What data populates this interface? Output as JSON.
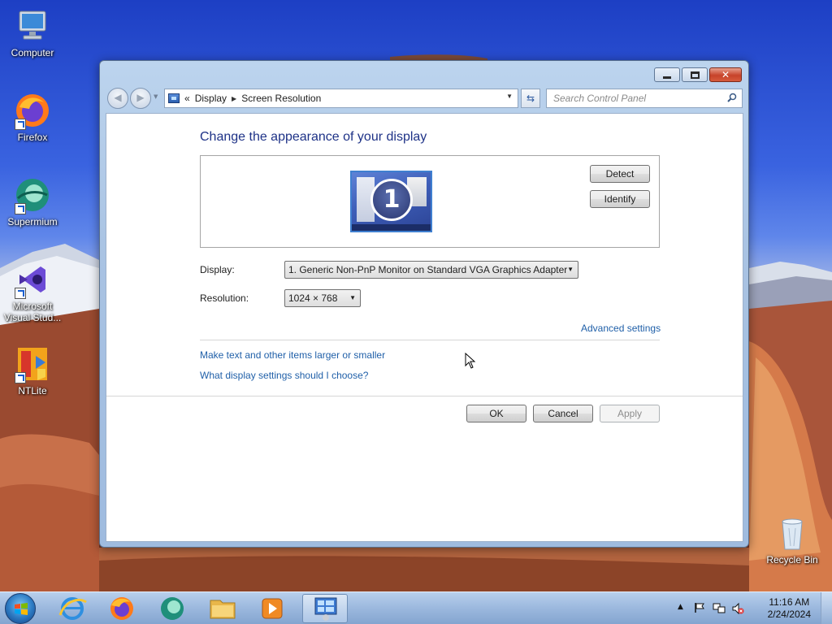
{
  "desktop": {
    "icons": [
      {
        "label": "Computer"
      },
      {
        "label": "Firefox"
      },
      {
        "label": "Supermium"
      },
      {
        "label": "Microsoft Visual Stud..."
      },
      {
        "label": "NTLite"
      },
      {
        "label": "Recycle Bin"
      }
    ]
  },
  "window": {
    "breadcrumb": {
      "overflow": "«",
      "items": [
        "Display",
        "Screen Resolution"
      ]
    },
    "search_placeholder": "Search Control Panel",
    "heading": "Change the appearance of your display",
    "preview": {
      "monitor_number": "1",
      "detect_label": "Detect",
      "identify_label": "Identify"
    },
    "form": {
      "display_label": "Display:",
      "display_value": "1. Generic Non-PnP Monitor on Standard VGA Graphics Adapter",
      "resolution_label": "Resolution:",
      "resolution_value": "1024 × 768"
    },
    "links": {
      "advanced": "Advanced settings",
      "text_size": "Make text and other items larger or smaller",
      "help": "What display settings should I choose?"
    },
    "buttons": {
      "ok": "OK",
      "cancel": "Cancel",
      "apply": "Apply"
    }
  },
  "taskbar": {
    "time": "11:16 AM",
    "date": "2/24/2024"
  },
  "colors": {
    "heading": "#1e3287",
    "link": "#1f5fa8",
    "window_frame": "#a9c3e3",
    "close_button": "#c7432a"
  }
}
